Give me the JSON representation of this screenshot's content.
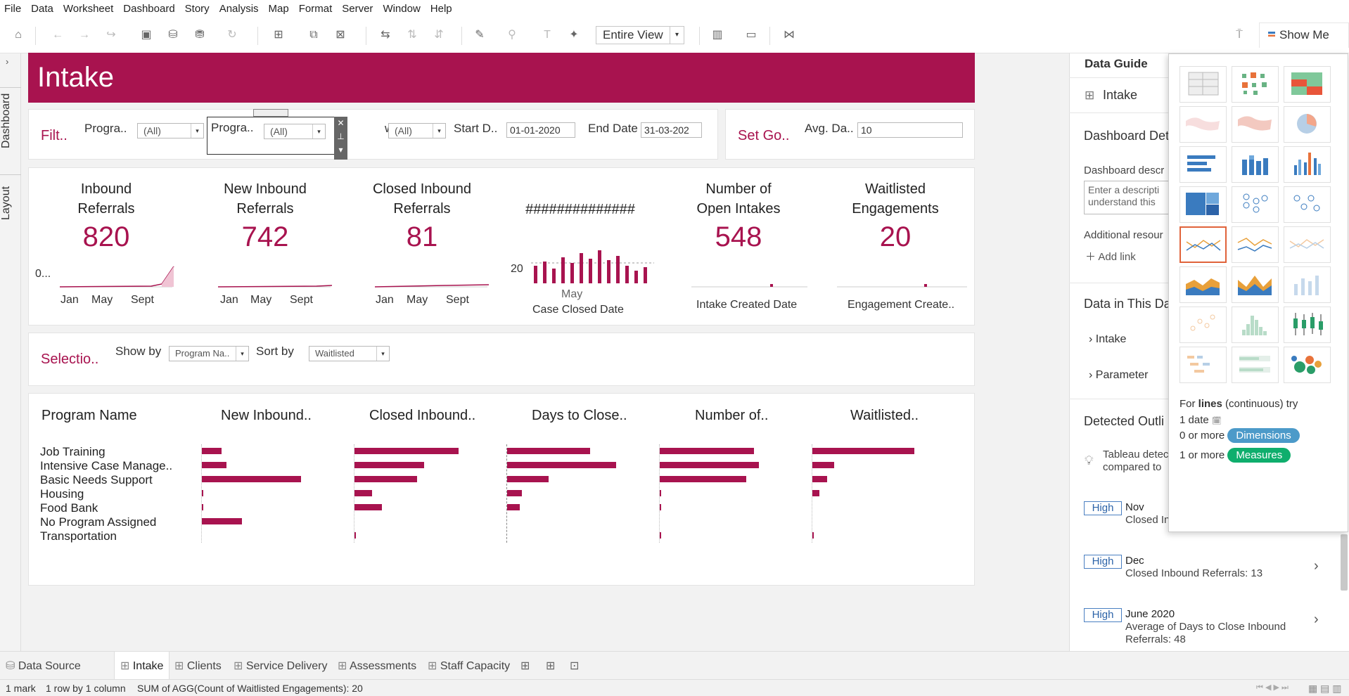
{
  "menu": [
    "File",
    "Data",
    "Worksheet",
    "Dashboard",
    "Story",
    "Analysis",
    "Map",
    "Format",
    "Server",
    "Window",
    "Help"
  ],
  "toolbar": {
    "fit": "Entire View",
    "show_me": "Show Me"
  },
  "left_tabs": {
    "dashboard": "Dashboard",
    "layout": "Layout"
  },
  "dashboard": {
    "title": "Intake",
    "filters": {
      "heading": "Filt..",
      "program1_label": "Progra..",
      "program1_value": "(All)",
      "program2_label": "Progra..",
      "program2_value": "(All)",
      "owner_label": "wner",
      "owner_value": "(All)",
      "start_label": "Start D..",
      "start_value": "01-01-2020",
      "end_label": "End Date",
      "end_value": "31-03-202"
    },
    "goals": {
      "heading": "Set Go..",
      "avg_label": "Avg. Da..",
      "avg_value": "10"
    },
    "kpis": [
      {
        "title1": "Inbound",
        "title2": "Referrals",
        "value": "820",
        "axis": [
          "Jan",
          "May",
          "Sept"
        ],
        "ytick": "0..."
      },
      {
        "title1": "New Inbound",
        "title2": "Referrals",
        "value": "742",
        "axis": [
          "Jan",
          "May",
          "Sept"
        ]
      },
      {
        "title1": "Closed Inbound",
        "title2": "Referrals",
        "value": "81",
        "axis": [
          "Jan",
          "May",
          "Sept"
        ]
      },
      {
        "title1": "##############",
        "value": "",
        "ytick": "20",
        "month": "May",
        "xlabel": "Case Closed Date"
      },
      {
        "title1": "Number of",
        "title2": "Open Intakes",
        "value": "548",
        "xlabel": "Intake Created Date"
      },
      {
        "title1": "Waitlisted",
        "title2": "Engagements",
        "value": "20",
        "xlabel": "Engagement Create.."
      }
    ],
    "selection": {
      "heading": "Selectio..",
      "show_by_label": "Show by",
      "show_by_value": "Program Na..",
      "sort_by_label": "Sort by",
      "sort_by_value": "Waitlisted"
    },
    "table": {
      "headers": [
        "Program Name",
        "New Inbound..",
        "Closed Inbound..",
        "Days to Close..",
        "Number of..",
        "Waitlisted.."
      ],
      "rows": [
        "Job Training",
        "Intensive Case Manage..",
        "Basic Needs Support",
        "Housing",
        "Food Bank",
        "No Program Assigned",
        "Transportation"
      ]
    }
  },
  "data_guide": {
    "title": "Data Guide",
    "sheet": "Intake",
    "dashboard_details": "Dashboard Det",
    "description_label": "Dashboard descr",
    "description_placeholder": "Enter a descripti understand this",
    "additional": "Additional resour",
    "add_link": "Add link",
    "data_heading": "Data in This Da",
    "data_items": [
      "Intake",
      "Parameter"
    ],
    "outliers_heading": "Detected Outli",
    "outlier_note_1": "Tableau detec",
    "outlier_note_2": "compared to",
    "outliers": [
      {
        "level": "High",
        "title": "Nov",
        "detail": "Closed In"
      },
      {
        "level": "High",
        "title": "Dec",
        "detail": "Closed Inbound Referrals: 13"
      },
      {
        "level": "High",
        "title": "June 2020",
        "detail": "Average of Days to Close Inbound",
        "detail2": "Referrals: 48"
      }
    ]
  },
  "show_me": {
    "hint_for": "For ",
    "hint_bold": "lines",
    "hint_rest": " (continuous) try",
    "req1": "1 date",
    "req2": "0 or more",
    "req2_pill": "Dimensions",
    "req3": "1 or more",
    "req3_pill": "Measures"
  },
  "sheet_tabs": [
    "Data Source",
    "Intake",
    "Clients",
    "Service Delivery",
    "Assessments",
    "Staff Capacity"
  ],
  "status": {
    "marks": "1 mark",
    "dims": "1 row by 1 column",
    "sum": "SUM of AGG(Count of Waitlisted Engagements): 20"
  },
  "colors": {
    "brand": "#a8134f",
    "dimensions_pill": "#4c9ac9",
    "measures_pill": "#0fae6d",
    "selected_chart": "#e0633a"
  }
}
